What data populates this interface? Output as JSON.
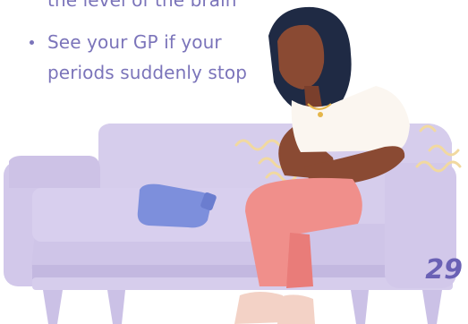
{
  "bullets": [
    {
      "lines": [
        "the level of the brain"
      ]
    },
    {
      "lines": [
        "See your GP if your",
        "periods suddenly stop"
      ]
    }
  ],
  "page_number": "29",
  "illustration": {
    "subject": "woman holding stomach on sofa with hot water bottle",
    "colors": {
      "text": "#7b74ba",
      "sofa": "#d6cdec",
      "sofa_shadow": "#c3b8e0",
      "skin": "#8a4a33",
      "top": "#fbf6f0",
      "trousers": "#f08f8b",
      "hot_water_bottle": "#7d8fdc",
      "pain_lines": "#f1d9a0"
    }
  }
}
